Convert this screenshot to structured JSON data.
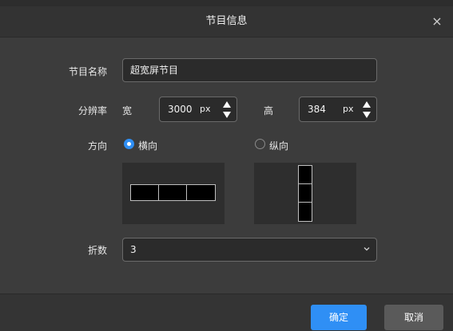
{
  "dialog": {
    "title": "节目信息",
    "close_symbol": "×"
  },
  "form": {
    "name_label": "节目名称",
    "name_value": "超宽屏节目",
    "resolution_label": "分辨率",
    "width_label": "宽",
    "width_value": "3000",
    "width_unit": "px",
    "height_label": "高",
    "height_value": "384",
    "height_unit": "px",
    "direction_label": "方向",
    "direction_options": [
      {
        "label": "横向",
        "selected": true
      },
      {
        "label": "纵向",
        "selected": false
      }
    ],
    "folds_label": "折数",
    "folds_value": "3"
  },
  "footer": {
    "ok_label": "确定",
    "cancel_label": "取消"
  },
  "colors": {
    "accent": "#2f8ff5",
    "background": "#3c3c3c"
  }
}
